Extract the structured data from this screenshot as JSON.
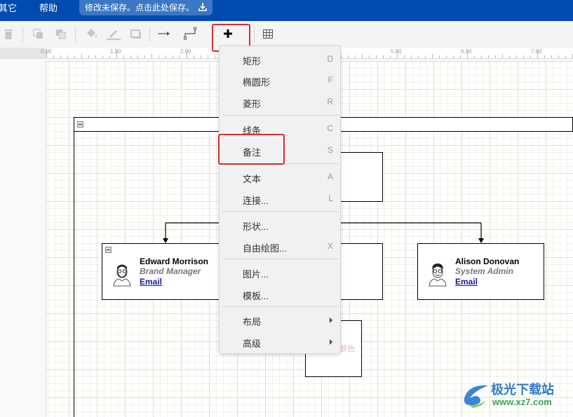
{
  "menubar": {
    "items": [
      {
        "label": "其它"
      },
      {
        "label": "帮助"
      }
    ],
    "save_banner": "修改未保存。点击此处保存。",
    "save_icon": "download-icon"
  },
  "toolbar": {
    "items": [
      {
        "icon": "trash-icon",
        "name": "delete"
      },
      {
        "icon": "to-front-icon",
        "name": "to-front"
      },
      {
        "icon": "to-back-icon",
        "name": "to-back"
      },
      {
        "icon": "fill-color-icon",
        "name": "fill-color"
      },
      {
        "icon": "line-color-icon",
        "name": "line-color"
      },
      {
        "icon": "shadow-icon",
        "name": "shadow"
      },
      {
        "icon": "connection-arrow-icon",
        "name": "connection"
      },
      {
        "icon": "waypoints-icon",
        "name": "waypoints"
      },
      {
        "icon": "plus-icon",
        "name": "insert"
      },
      {
        "icon": "table-icon",
        "name": "table"
      }
    ]
  },
  "ruler": {
    "labels": [
      "0.00",
      "1.00",
      "2.00",
      "5.00",
      "6.00",
      "7.00"
    ]
  },
  "insert_menu": {
    "groups": [
      [
        {
          "label": "矩形",
          "shortcut": "D"
        },
        {
          "label": "椭圆形",
          "shortcut": "F"
        },
        {
          "label": "菱形",
          "shortcut": "R"
        }
      ],
      [
        {
          "label": "线条",
          "shortcut": "C"
        },
        {
          "label": "备注",
          "shortcut": "S"
        }
      ],
      [
        {
          "label": "文本",
          "shortcut": "A"
        },
        {
          "label": "连接...",
          "shortcut": "L"
        }
      ],
      [
        {
          "label": "形状...",
          "shortcut": ""
        },
        {
          "label": "自由绘图...",
          "shortcut": "X"
        }
      ],
      [
        {
          "label": "图片...",
          "shortcut": ""
        },
        {
          "label": "模板...",
          "shortcut": ""
        }
      ],
      [
        {
          "label": "布局",
          "shortcut": "",
          "submenu": true
        },
        {
          "label": "高级",
          "shortcut": "",
          "submenu": true
        }
      ]
    ]
  },
  "diagram": {
    "people": [
      {
        "name": "Edward Morrison",
        "role": "Brand Manager",
        "email": "Email"
      },
      {
        "name": "Alison Donovan",
        "role": "System Admin",
        "email": "Email"
      }
    ],
    "partial_text": "颜色"
  },
  "watermark": {
    "title": "极光下载站",
    "url": "www.xz7.com"
  }
}
